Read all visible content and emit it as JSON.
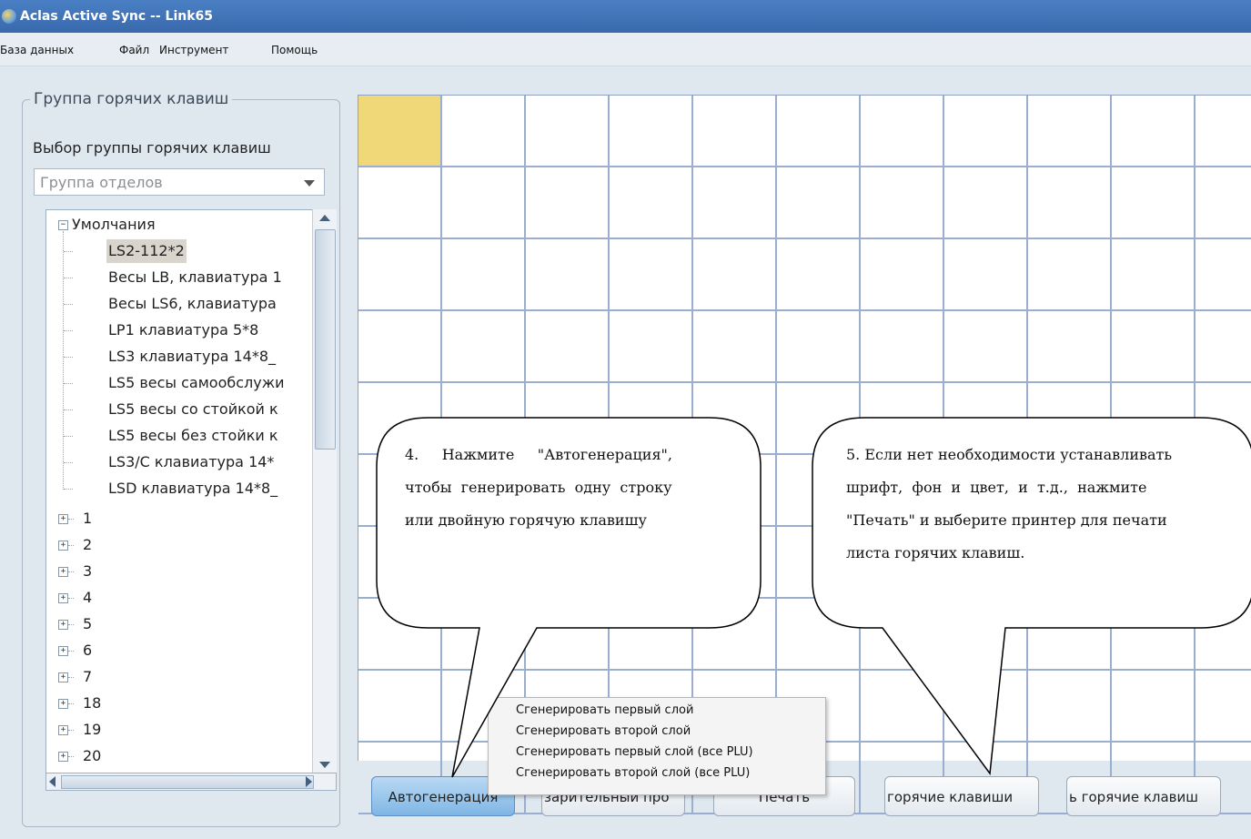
{
  "window": {
    "title": "Aclas Active Sync -- Link65",
    "icon": "app-globe-icon"
  },
  "menu": [
    "База данных",
    "Файл",
    "Инструмент",
    "Помощь"
  ],
  "hotkey_group": {
    "legend": "Группа горячих клавиш",
    "select_label": "Выбор группы горячих клавиш",
    "combo_value": "Группа отделов",
    "tree": {
      "root": "Умолчания",
      "children": [
        "LS2-112*2",
        "Весы LB, клавиатура 1",
        "Весы LS6, клавиатура",
        "LP1 клавиатура 5*8",
        "LS3 клавиатура 14*8_",
        "LS5 весы самообслужи",
        "LS5 весы со стойкой к",
        "LS5 весы без стойки к",
        "LS3/C клавиатура 14*",
        "LSD клавиатура 14*8_"
      ],
      "selected": "LS2-112*2",
      "groups": [
        "1",
        "2",
        "3",
        "4",
        "5",
        "6",
        "7",
        "18",
        "19",
        "20"
      ]
    }
  },
  "buttons": {
    "autogen": "Автогенерация",
    "preview": "зарительный про",
    "print": "Печать",
    "hotkeys1": "горячие клавиши",
    "hotkeys2": "ь горячие клавиш"
  },
  "popup_menu": [
    "Сгенерировать первый слой",
    "Сгенерировать второй слой",
    "Сгенерировать первый слой (все PLU)",
    "Сгенерировать второй слой (все PLU)"
  ],
  "callouts": {
    "left_lines": [
      "4.     Нажмите     \"Автогенерация\",",
      "чтобы  генерировать  одну  строку",
      "или двойную горячую клавишу"
    ],
    "right_lines": [
      "5. Если нет необходимости устанавливать",
      "шрифт,  фон  и  цвет,  и  т.д.,  нажмите",
      "\"Печать\" и выберите принтер для печати",
      "листа горячих клавиш."
    ]
  },
  "colors": {
    "active_cell": "#f0d778",
    "grid_line": "#9aaed0",
    "titlebar": "#3a69ad"
  }
}
